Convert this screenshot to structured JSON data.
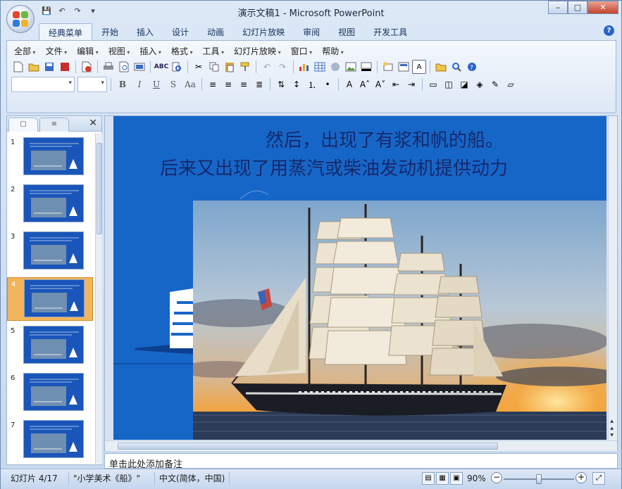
{
  "window": {
    "title": "演示文稿1 - Microsoft PowerPoint",
    "minimize": "‒",
    "maximize": "□",
    "close": "✕"
  },
  "qat": {
    "save": "💾",
    "undo": "↶",
    "redo": "↷",
    "more": "▾"
  },
  "tabs": [
    "经典菜单",
    "开始",
    "插入",
    "设计",
    "动画",
    "幻灯片放映",
    "审阅",
    "视图",
    "开发工具"
  ],
  "help": "?",
  "menus": [
    "全部",
    "文件",
    "编辑",
    "视图",
    "插入",
    "格式",
    "工具",
    "幻灯片放映",
    "窗口",
    "帮助"
  ],
  "format_buttons": {
    "bold": "B",
    "italic": "I",
    "underline": "U",
    "shadow": "S",
    "case": "Aa"
  },
  "panel": {
    "tab_slides": "▢",
    "tab_outline": "≡",
    "close": "✕",
    "slides": [
      {
        "num": "1"
      },
      {
        "num": "2"
      },
      {
        "num": "3"
      },
      {
        "num": "4"
      },
      {
        "num": "5"
      },
      {
        "num": "6"
      },
      {
        "num": "7"
      }
    ],
    "selected": "4"
  },
  "slide": {
    "line1": "然后，出现了有浆和帆的船。",
    "line2": "后来又出现了用蒸汽或柴油发动机提供动力"
  },
  "notes": "单击此处添加备注",
  "status": {
    "slide_info": "幻灯片 4/17",
    "theme": "\"小学美术《船》\"",
    "language": "中文(简体，中国)",
    "zoom": "90%",
    "zoom_fraction": 0.5
  },
  "colors": {
    "slide_bg": "#1666c8",
    "title_text": "#16296b",
    "selected_thumb": "#f2b45a"
  }
}
